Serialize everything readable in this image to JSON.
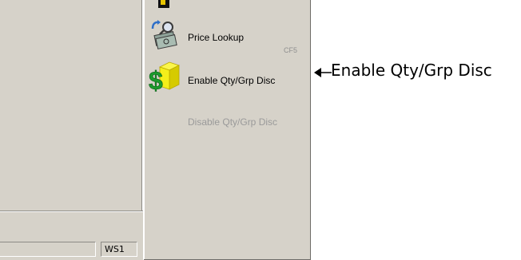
{
  "status_bar": {
    "workstation": "WS1"
  },
  "menu": {
    "price_lookup": {
      "label": "Price Lookup",
      "shortcut": "CF5",
      "icon": "money-search-icon"
    },
    "enable_qty_grp_disc": {
      "label": "Enable Qty/Grp Disc",
      "icon": "dollar-box-icon"
    },
    "disable_qty_grp_disc": {
      "label": "Disable Qty/Grp Disc",
      "enabled": false
    }
  },
  "annotation": {
    "text": "Enable Qty/Grp Disc"
  },
  "colors": {
    "panel_bg": "#d6d2c9",
    "dollar_green": "#1a9b2b",
    "box_yellow": "#f4ef1a",
    "disabled_text": "#9a9a9a"
  }
}
